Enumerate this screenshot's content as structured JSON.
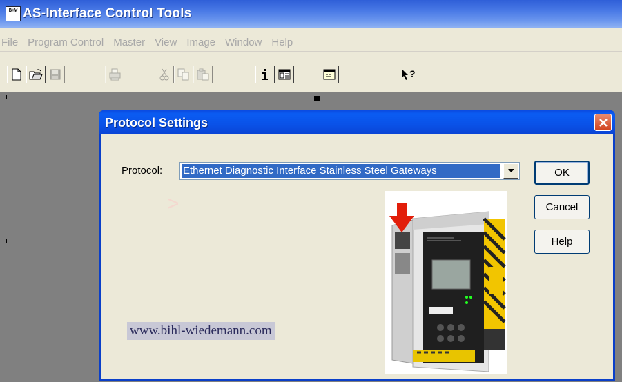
{
  "app": {
    "title": "AS-Interface Control Tools",
    "logo_text": "B+W"
  },
  "menu": [
    "File",
    "Program Control",
    "Master",
    "View",
    "Image",
    "Window",
    "Help"
  ],
  "toolbar": {
    "buttons": [
      {
        "name": "new-icon",
        "enabled": true
      },
      {
        "name": "open-icon",
        "enabled": true
      },
      {
        "name": "save-icon",
        "enabled": false
      },
      {
        "name": "print-icon",
        "enabled": false
      },
      {
        "name": "cut-icon",
        "enabled": false
      },
      {
        "name": "copy-icon",
        "enabled": false
      },
      {
        "name": "paste-icon",
        "enabled": false
      },
      {
        "name": "info-icon",
        "enabled": true
      },
      {
        "name": "view-icon",
        "enabled": true
      },
      {
        "name": "window-icon",
        "enabled": true
      },
      {
        "name": "context-help-icon",
        "enabled": true
      }
    ]
  },
  "dialog": {
    "title": "Protocol Settings",
    "protocol_label": "Protocol:",
    "protocol_value": "Ethernet Diagnostic Interface Stainless Steel Gateways",
    "ok_label": "OK",
    "cancel_label": "Cancel",
    "help_label": "Help",
    "website": "www.bihl-wiedemann.com"
  },
  "colors": {
    "title_gradient_start": "#2f5fd8",
    "dialog_title": "#0a52e8",
    "selection": "#316ac5",
    "close_button": "#d2431f",
    "arrow_red": "#e21e0a"
  }
}
